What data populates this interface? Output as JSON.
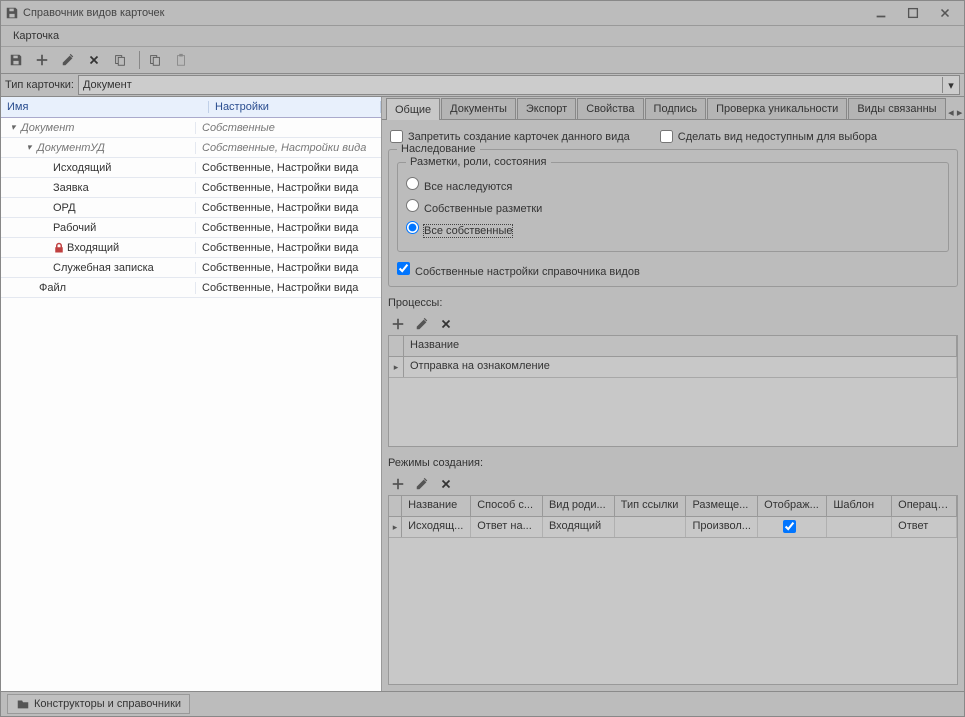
{
  "window_title": "Справочник видов карточек",
  "menu": {
    "card": "Карточка"
  },
  "card_type_label": "Тип карточки:",
  "card_type_value": "Документ",
  "tree": {
    "headers": {
      "name": "Имя",
      "settings": "Настройки"
    },
    "rows": [
      {
        "label": "Документ",
        "settings": "Собственные",
        "indent": 0,
        "italic": true,
        "expanded": true,
        "type": "group"
      },
      {
        "label": "ДокументУД",
        "settings": "Собственные, Настройки вида",
        "indent": 1,
        "italic": true,
        "expanded": true,
        "type": "group"
      },
      {
        "label": "Исходящий",
        "settings": "Собственные, Настройки вида",
        "indent": 2,
        "type": "item"
      },
      {
        "label": "Заявка",
        "settings": "Собственные, Настройки вида",
        "indent": 2,
        "type": "item"
      },
      {
        "label": "ОРД",
        "settings": "Собственные, Настройки вида",
        "indent": 2,
        "type": "item"
      },
      {
        "label": "Рабочий",
        "settings": "Собственные, Настройки вида",
        "indent": 2,
        "type": "item"
      },
      {
        "label": "Входящий",
        "settings": "Собственные, Настройки вида",
        "indent": 2,
        "type": "item",
        "locked": true
      },
      {
        "label": "Служебная записка",
        "settings": "Собственные, Настройки вида",
        "indent": 2,
        "type": "item"
      },
      {
        "label": "Файл",
        "settings": "Собственные, Настройки вида",
        "indent": 2,
        "type": "item",
        "indent_override": "indent-2b"
      }
    ]
  },
  "tabs": [
    "Общие",
    "Документы",
    "Экспорт",
    "Свойства",
    "Подпись",
    "Проверка уникальности",
    "Виды связанны"
  ],
  "active_tab": 0,
  "checkboxes": {
    "forbid_create": "Запретить создание карточек данного вида",
    "make_unavailable": "Сделать вид недоступным для выбора"
  },
  "inheritance_group": "Наследование",
  "inner_group": "Разметки, роли, состояния",
  "radios": {
    "all_inherited": "Все наследуются",
    "own_markups": "Собственные разметки",
    "all_own": "Все собственные"
  },
  "own_settings_checkbox": "Собственные настройки справочника видов",
  "processes_label": "Процессы:",
  "process_grid": {
    "header": "Название",
    "rows": [
      "Отправка на ознакомление"
    ]
  },
  "modes_label": "Режимы создания:",
  "modes_grid": {
    "headers": [
      "Название",
      "Способ с...",
      "Вид роди...",
      "Тип ссылки",
      "Размеще...",
      "Отображ...",
      "Шаблон",
      "Операци..."
    ],
    "rows": [
      {
        "name": "Исходящ...",
        "method": "Ответ на...",
        "parent": "Входящий",
        "link": "",
        "place": "Произвол...",
        "display": true,
        "template": "",
        "op": "Ответ"
      }
    ]
  },
  "footer_button": "Конструкторы и справочники"
}
